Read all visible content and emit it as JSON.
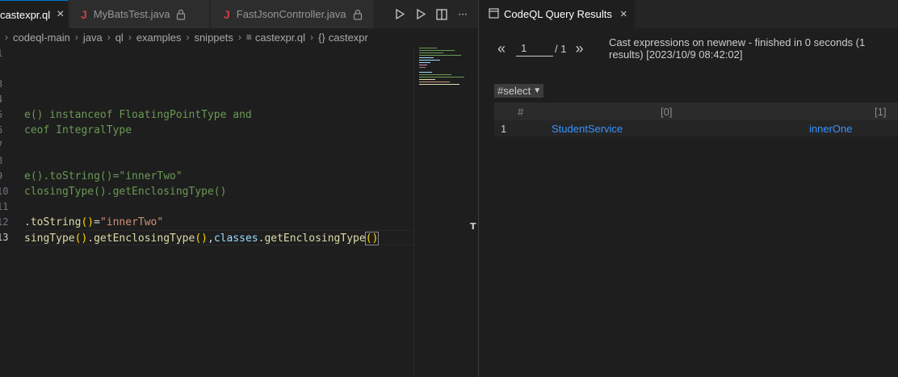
{
  "editor": {
    "tabs": [
      {
        "label": "castexpr.ql",
        "active": true,
        "close": "×"
      },
      {
        "label": "MyBatsTest.java",
        "icon": "J",
        "lock": true
      },
      {
        "label": "FastJsonController.java",
        "icon": "J",
        "lock": true
      }
    ],
    "actions": [
      "run-icon",
      "run-outline-icon",
      "split-editor-icon",
      "more-icon"
    ],
    "more_label": "···",
    "breadcrumb": [
      "codeql-main",
      "java",
      "ql",
      "examples",
      "snippets",
      "castexpr.ql",
      "castexpr"
    ],
    "line_numbers": [
      "1",
      "",
      "3",
      "4",
      "5",
      "6",
      "7",
      "8",
      "9",
      "10",
      "11",
      "12",
      "13"
    ],
    "code": {
      "l5": "e() instanceof FloatingPointType and",
      "l6": "ceof IntegralType",
      "l9_a": "e().toString()=",
      "l9_b": "\"innerTwo\"",
      "l10": "closingType().getEnclosingType()",
      "l12_a": ".toString",
      "l12_b": "()",
      "l12_c": "=",
      "l12_d": "\"innerTwo\"",
      "l13_a": "singType",
      "l13_b": "()",
      "l13_c": ".getEnclosingType",
      "l13_d": "()",
      "l13_e": ",",
      "l13_f": "classes",
      "l13_g": ".getEnclosingType",
      "l13_h": "()"
    },
    "scrollbar_marker": "T"
  },
  "results": {
    "tab_label": "CodeQL Query Results",
    "tab_close": "×",
    "pager": {
      "prev": "«",
      "page": "1",
      "total": "/ 1",
      "next": "»"
    },
    "status": "Cast expressions on newnew - finished in 0 seconds (1 results) [2023/10/9 08:42:02]",
    "select_value": "#select",
    "table": {
      "headers": [
        "#",
        "[0]",
        "[1]"
      ],
      "rows": [
        {
          "num": "1",
          "c0": "StudentService",
          "c1": "innerOne"
        }
      ]
    }
  },
  "colors": {
    "accent": "#0078d4",
    "link": "#3794ff",
    "comment": "#6a9955",
    "string": "#ce9178",
    "function": "#dcdcaa",
    "variable": "#9cdcfe",
    "bracket": "#ffd700"
  }
}
